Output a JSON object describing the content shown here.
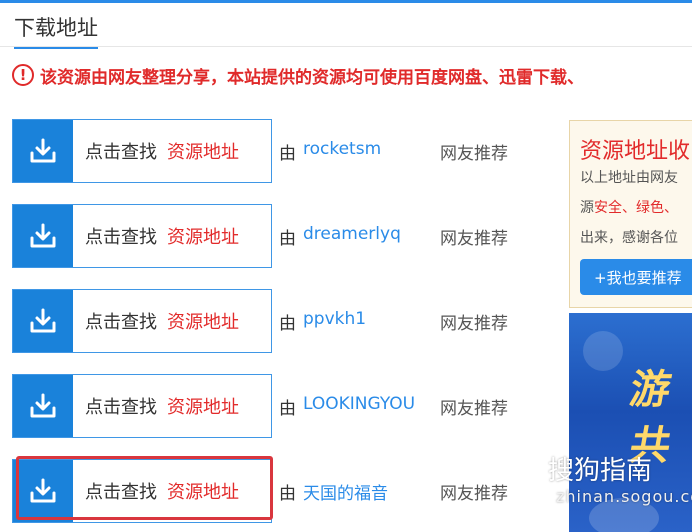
{
  "section": {
    "title": "下载地址"
  },
  "notice": {
    "icon": "exclamation-icon",
    "text": "该资源由网友整理分享，本站提供的资源均可使用百度网盘、迅雷下载、"
  },
  "rows": [
    {
      "btn_text": "点击查找",
      "btn_accent": "资源地址",
      "by": "由",
      "user": "rocketsm",
      "rec": "网友推荐"
    },
    {
      "btn_text": "点击查找",
      "btn_accent": "资源地址",
      "by": "由",
      "user": "dreamerlyq",
      "rec": "网友推荐"
    },
    {
      "btn_text": "点击查找",
      "btn_accent": "资源地址",
      "by": "由",
      "user": "ppvkh1",
      "rec": "网友推荐"
    },
    {
      "btn_text": "点击查找",
      "btn_accent": "资源地址",
      "by": "由",
      "user": "LOOKINGYOU",
      "rec": "网友推荐"
    },
    {
      "btn_text": "点击查找",
      "btn_accent": "资源地址",
      "by": "由",
      "user": "天国的福音",
      "rec": "网友推荐"
    }
  ],
  "side": {
    "title": "资源地址收",
    "line1": "以上地址由网友",
    "line2_pre": "源",
    "line2_red": "安全、绿色、",
    "line3": "出来，感谢各位",
    "button": "+我也要推荐"
  },
  "banner": {
    "text1": "游",
    "text2": "共"
  },
  "watermark": {
    "logo": "S",
    "text": "搜狗指南",
    "url": "zhinan.sogou.com"
  },
  "colors": {
    "accent": "#2a8be8",
    "red": "#e22b2b",
    "icon_box": "#1a82da"
  }
}
